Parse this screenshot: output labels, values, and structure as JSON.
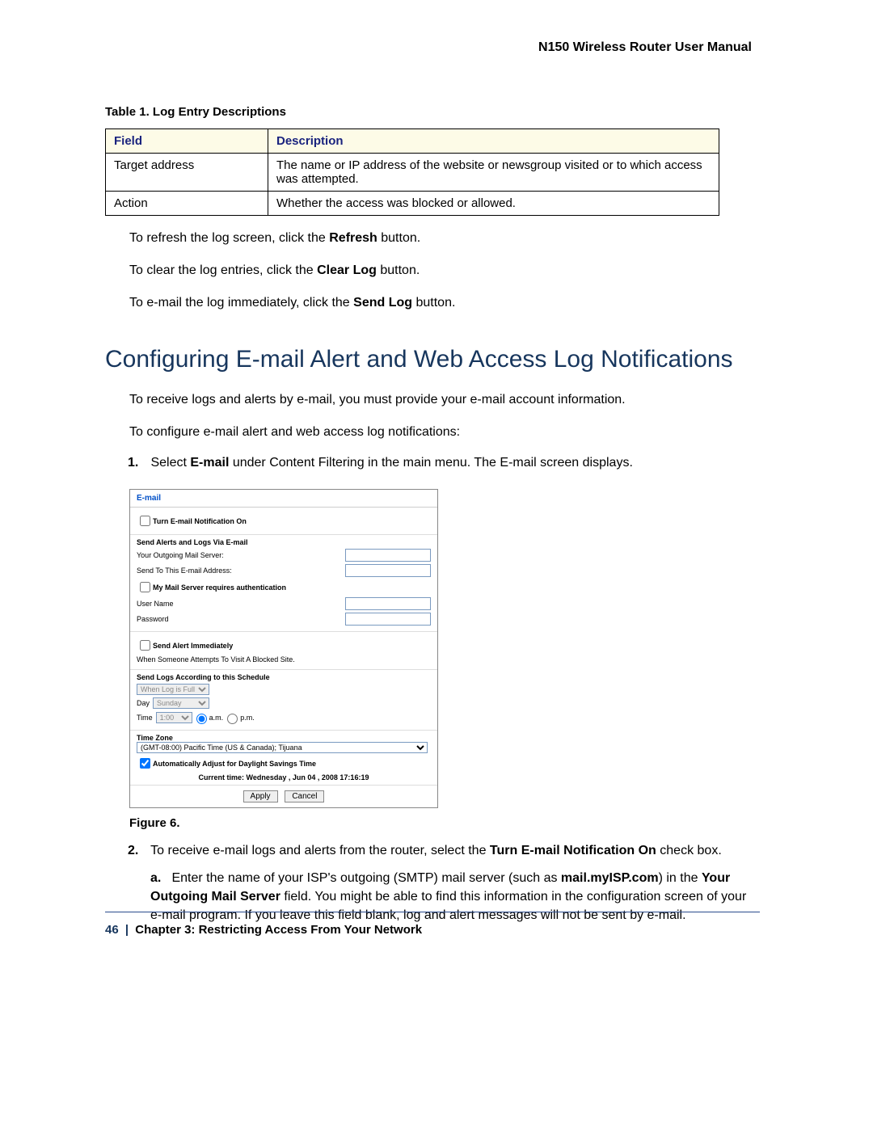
{
  "header": {
    "doc_title": "N150 Wireless Router User Manual"
  },
  "table_caption": "Table 1.  Log Entry Descriptions",
  "table": {
    "head_field": "Field",
    "head_desc": "Description",
    "rows": [
      {
        "field": "Target address",
        "desc": "The name or IP address of the website or newsgroup visited or to which access was attempted."
      },
      {
        "field": "Action",
        "desc": "Whether the access was blocked or allowed."
      }
    ]
  },
  "para_refresh_a": "To refresh the log screen, click the ",
  "para_refresh_b": "Refresh",
  "para_refresh_c": " button.",
  "para_clear_a": "To clear the log entries, click the ",
  "para_clear_b": "Clear Log",
  "para_clear_c": " button.",
  "para_send_a": "To e-mail the log immediately, click the ",
  "para_send_b": "Send Log",
  "para_send_c": " button.",
  "section_heading": "Configuring E-mail Alert and Web Access Log Notifications",
  "intro1": "To receive logs and alerts by e-mail, you must provide your e-mail account information.",
  "intro2": "To configure e-mail alert and web access log notifications:",
  "step1_a": "Select ",
  "step1_b": "E-mail",
  "step1_c": " under Content Filtering in the main menu. The E-mail screen displays.",
  "figure_caption": "Figure 6.",
  "step2_a": "To receive e-mail logs and alerts from the router, select the ",
  "step2_b": "Turn E-mail Notification On",
  "step2_c": " check box.",
  "step2a_pre": "Enter the name of your ISP's outgoing (SMTP) mail server (such as ",
  "step2a_ex": "mail.myISP.com",
  "step2a_mid": ") in the ",
  "step2a_f": "Your Outgoing Mail Server",
  "step2a_post": " field. You might be able to find this information in the configuration screen of your e-mail program. If you leave this field blank, log and alert messages will not be sent by e-mail.",
  "email_panel": {
    "title": "E-mail",
    "turn_on": "Turn E-mail Notification On",
    "send_via": "Send Alerts and Logs Via E-mail",
    "out_server": "Your Outgoing Mail Server:",
    "send_to": "Send To This E-mail Address:",
    "auth": "My Mail Server requires authentication",
    "user": "User Name",
    "pass": "Password",
    "alert_imm": "Send Alert Immediately",
    "alert_when": "When Someone Attempts To Visit A Blocked Site.",
    "sched": "Send Logs According to this Schedule",
    "when_full": "When Log is Full",
    "day_lbl": "Day",
    "day_val": "Sunday",
    "time_lbl": "Time",
    "time_val": "1:00",
    "am": "a.m.",
    "pm": "p.m.",
    "tz": "Time Zone",
    "tz_val": "(GMT-08:00) Pacific Time (US & Canada); Tijuana",
    "dst": "Automatically Adjust for Daylight Savings Time",
    "current": "Current time: Wednesday , Jun 04 , 2008 17:16:19",
    "apply": "Apply",
    "cancel": "Cancel"
  },
  "footer": {
    "page": "46",
    "sep": "|",
    "chapter": "Chapter 3:  Restricting Access From Your Network"
  }
}
